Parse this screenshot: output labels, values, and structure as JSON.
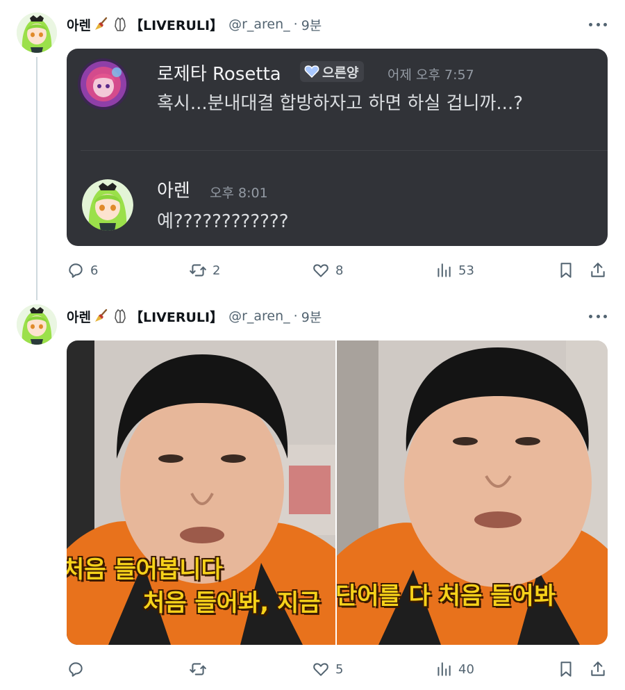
{
  "tweets": [
    {
      "display_name": "아렌",
      "tag": "【LIVERULI】",
      "handle": "@r_aren_",
      "separator": "·",
      "time": "9분",
      "embed": {
        "messages": [
          {
            "author": "로제타 Rosetta",
            "badge": "으른양",
            "timestamp": "어제 오후 7:57",
            "text": "혹시...분내대결 합방하자고 하면 하실 겁니까...?"
          },
          {
            "author": "아렌",
            "timestamp": "오후 8:01",
            "text": "예????????????"
          }
        ]
      },
      "stats": {
        "replies": "6",
        "reposts": "2",
        "likes": "8",
        "views": "53"
      }
    },
    {
      "display_name": "아렌",
      "tag": "【LIVERULI】",
      "handle": "@r_aren_",
      "separator": "·",
      "time": "9분",
      "media": {
        "left_caption_1": "처음 들어봅니다",
        "left_caption_2": "처음 들어봐, 지금",
        "right_caption": "단어를 다 처음 들어봐"
      },
      "stats": {
        "replies": "",
        "reposts": "",
        "likes": "5",
        "views": "40"
      }
    }
  ],
  "icons": [
    "more-icon",
    "reply-icon",
    "repost-icon",
    "like-icon",
    "views-icon",
    "bookmark-icon",
    "share-icon",
    "broom-icon",
    "hands-icon",
    "heart-badge-icon"
  ],
  "colors": {
    "card_bg": "#313338",
    "muted": "#536471",
    "caption": "#f6d21a",
    "jacket": "#e8721c"
  }
}
